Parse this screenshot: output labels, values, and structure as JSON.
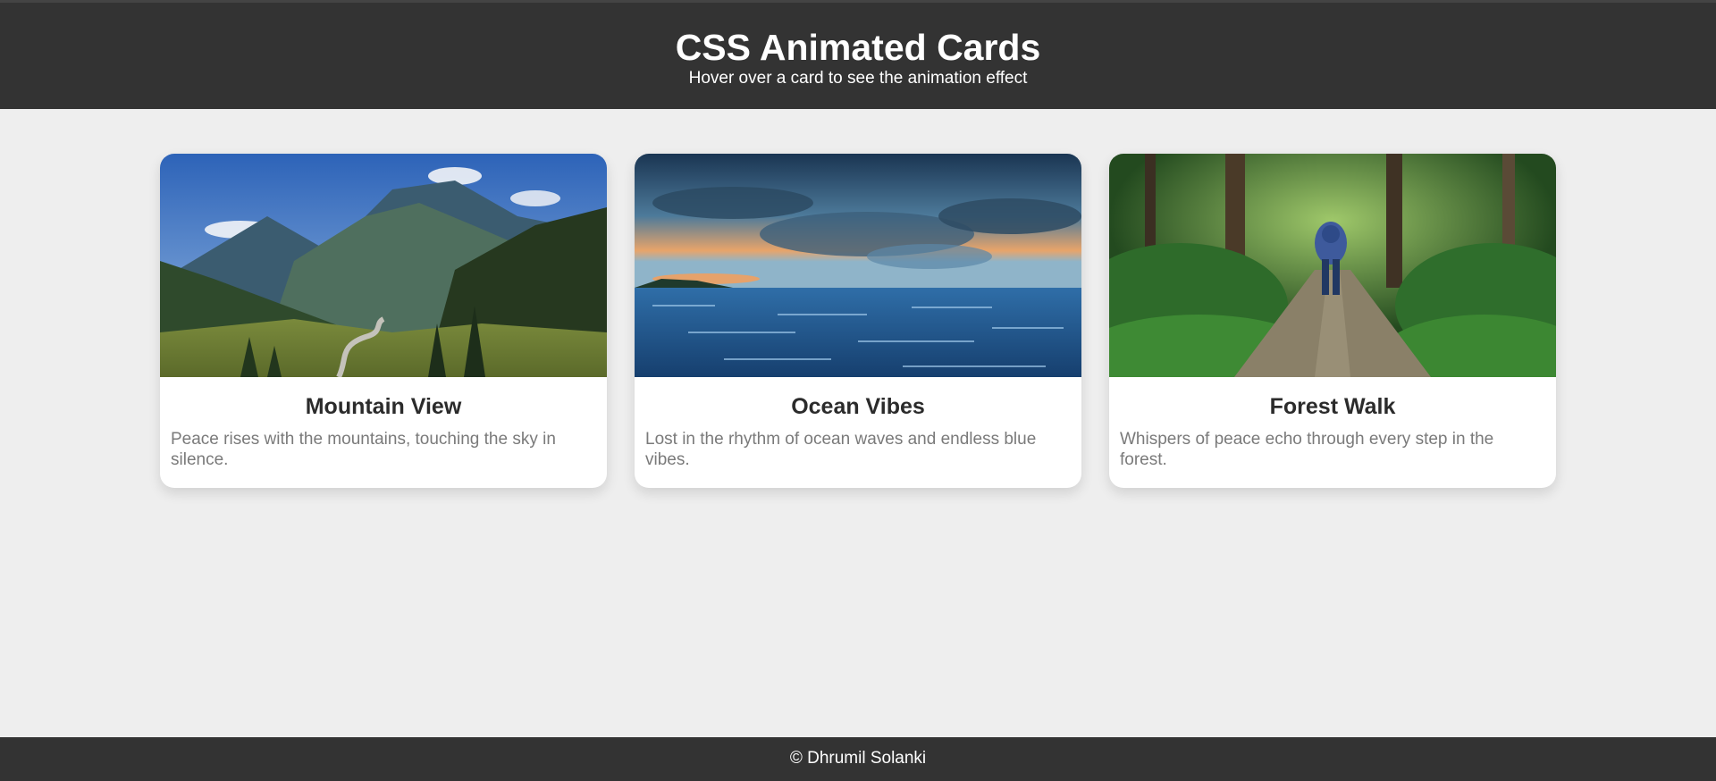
{
  "header": {
    "title": "CSS Animated Cards",
    "subtitle": "Hover over a card to see the animation effect"
  },
  "cards": [
    {
      "title": "Mountain View",
      "description": "Peace rises with the mountains, touching the sky in silence.",
      "image": "mountain-valley-photo"
    },
    {
      "title": "Ocean Vibes",
      "description": "Lost in the rhythm of ocean waves and endless blue vibes.",
      "image": "ocean-sunset-photo"
    },
    {
      "title": "Forest Walk",
      "description": "Whispers of peace echo through every step in the forest.",
      "image": "forest-path-photo"
    }
  ],
  "footer": {
    "text": "© Dhrumil Solanki"
  },
  "colors": {
    "header_bg": "#333333",
    "page_bg": "#eeeeee",
    "card_bg": "#ffffff",
    "title_text": "#2b2b2b",
    "description_text": "#7a7a7a"
  }
}
